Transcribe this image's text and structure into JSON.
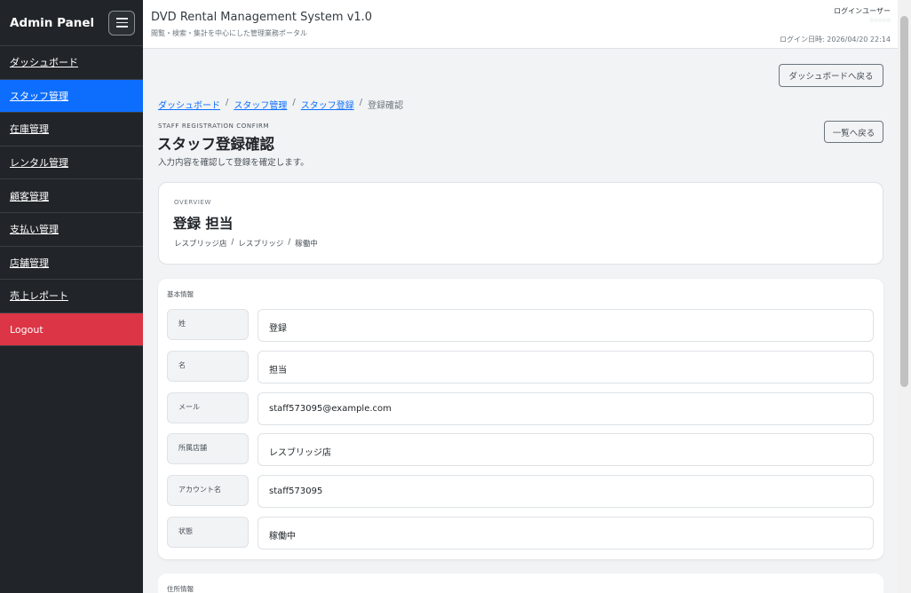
{
  "sidebar": {
    "brand": "Admin Panel",
    "items": [
      {
        "label": "ダッシュボード"
      },
      {
        "label": "スタッフ管理"
      },
      {
        "label": "在庫管理"
      },
      {
        "label": "レンタル管理"
      },
      {
        "label": "顧客管理"
      },
      {
        "label": "支払い管理"
      },
      {
        "label": "店舗管理"
      },
      {
        "label": "売上レポート"
      }
    ],
    "logout": "Logout",
    "active_index": 1,
    "colors": {
      "bg": "#212529",
      "active": "#0d6efd",
      "logout": "#dc3545"
    }
  },
  "header": {
    "title": "DVD Rental Management System v1.0",
    "subtitle": "閲覧・検索・集計を中心にした管理業務ポータル",
    "login_user_label": "ログインユーザー",
    "login_user_name": "•••••",
    "login_time": "ログイン日時: 2026/04/20 22:14"
  },
  "main": {
    "back_dashboard": "ダッシュボードへ戻る",
    "breadcrumb": {
      "items": [
        "ダッシュボード",
        "スタッフ管理",
        "スタッフ登録"
      ],
      "current": "登録確認",
      "sep": "/"
    },
    "eyebrow": "STAFF REGISTRATION CONFIRM",
    "title": "スタッフ登録確認",
    "description": "入力内容を確認して登録を確定します。",
    "back_list": "一覧へ戻る",
    "overview": {
      "label": "OVERVIEW",
      "name": "登録 担当",
      "store": "レスブリッジ店",
      "city": "レスブリッジ",
      "status": "稼働中",
      "sep": "/"
    },
    "basic_info": {
      "title": "基本情報",
      "fields": [
        {
          "label": "姓",
          "value": "登録"
        },
        {
          "label": "名",
          "value": "担当"
        },
        {
          "label": "メール",
          "value": "staff573095@example.com"
        },
        {
          "label": "所属店舗",
          "value": "レスブリッジ店"
        },
        {
          "label": "アカウント名",
          "value": "staff573095"
        },
        {
          "label": "状態",
          "value": "稼働中"
        }
      ]
    },
    "address_info": {
      "title": "住所情報"
    }
  }
}
